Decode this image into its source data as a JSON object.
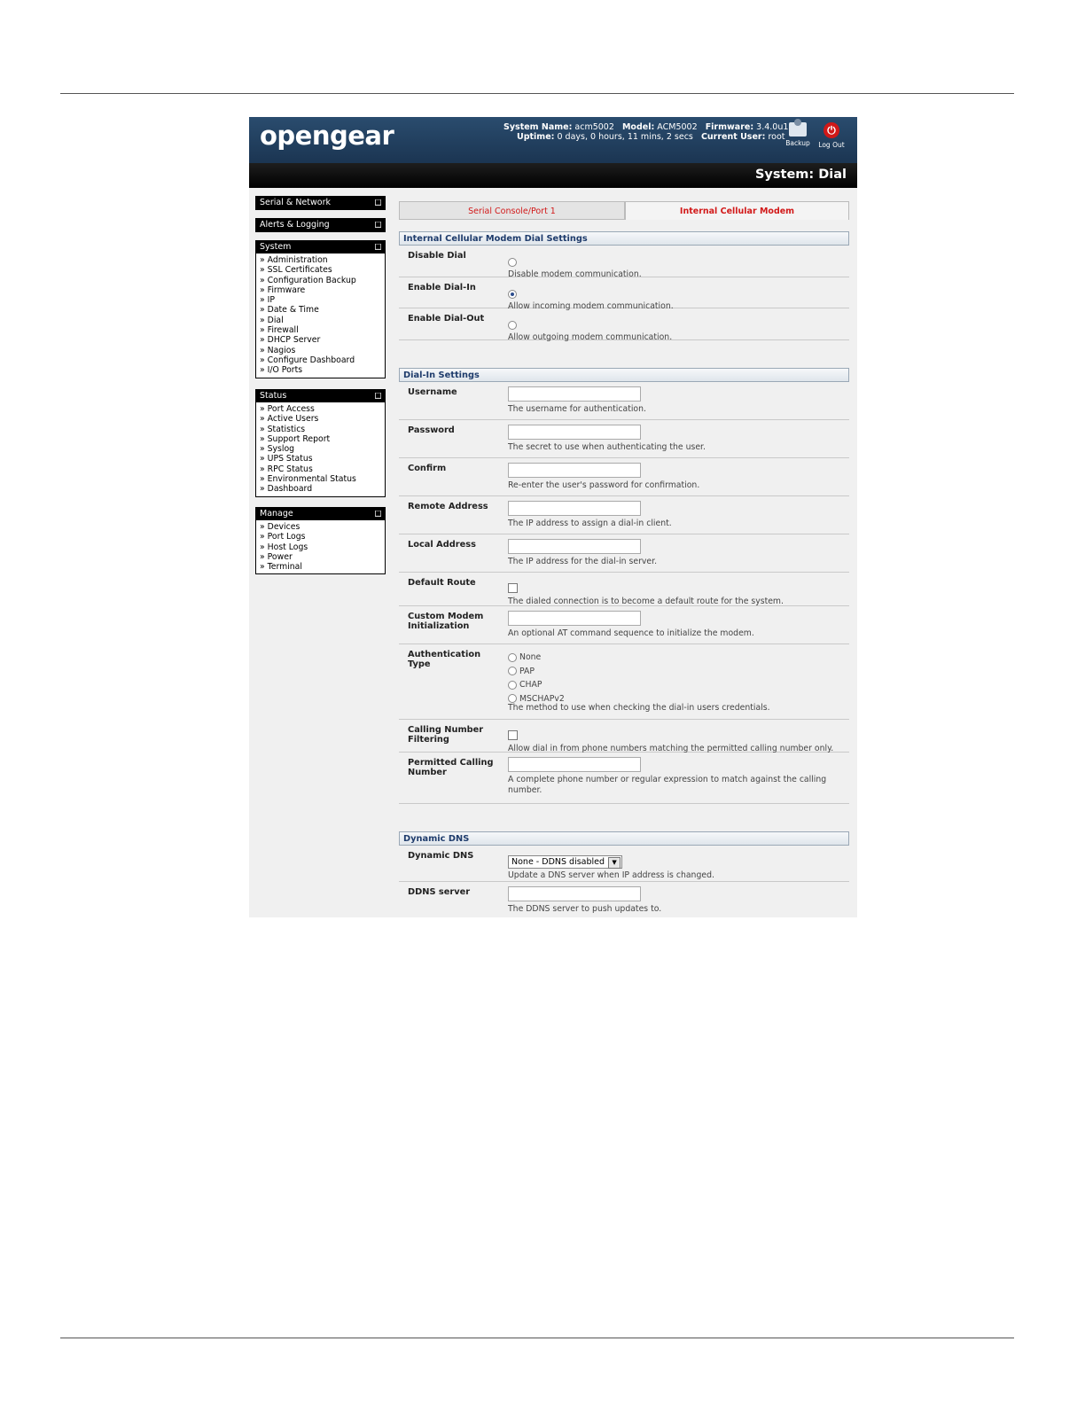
{
  "header": {
    "logo": "opengear",
    "system_name_label": "System Name:",
    "system_name": "acm5002",
    "model_label": "Model:",
    "model": "ACM5002",
    "firmware_label": "Firmware:",
    "firmware": "3.4.0u1",
    "uptime_label": "Uptime:",
    "uptime": "0 days, 0 hours, 11 mins, 2 secs",
    "current_user_label": "Current User:",
    "current_user": "root",
    "backup_label": "Backup",
    "logout_label": "Log Out",
    "page_title": "System: Dial"
  },
  "sidebar": {
    "serial_network": "Serial & Network",
    "alerts_logging": "Alerts & Logging",
    "system": {
      "title": "System",
      "items": [
        "Administration",
        "SSL Certificates",
        "Configuration Backup",
        "Firmware",
        "IP",
        "Date & Time",
        "Dial",
        "Firewall",
        "DHCP Server",
        "Nagios",
        "Configure Dashboard",
        "I/O Ports"
      ]
    },
    "status": {
      "title": "Status",
      "items": [
        "Port Access",
        "Active Users",
        "Statistics",
        "Support Report",
        "Syslog",
        "UPS Status",
        "RPC Status",
        "Environmental Status",
        "Dashboard"
      ]
    },
    "manage": {
      "title": "Manage",
      "items": [
        "Devices",
        "Port Logs",
        "Host Logs",
        "Power",
        "Terminal"
      ]
    },
    "toggle_glyph": "■"
  },
  "tabs": [
    "Serial Console/Port 1",
    "Internal Cellular Modem"
  ],
  "modem_section": {
    "title": "Internal Cellular Modem Dial Settings",
    "rows": [
      {
        "label": "Disable Dial",
        "desc": "Disable modem communication.",
        "checked": false
      },
      {
        "label": "Enable Dial-In",
        "desc": "Allow incoming modem communication.",
        "checked": true
      },
      {
        "label": "Enable Dial-Out",
        "desc": "Allow outgoing modem communication.",
        "checked": false
      }
    ]
  },
  "dialin_section": {
    "title": "Dial-In Settings",
    "username": {
      "label": "Username",
      "desc": "The username for authentication.",
      "value": ""
    },
    "password": {
      "label": "Password",
      "desc": "The secret to use when authenticating the user.",
      "value": ""
    },
    "confirm": {
      "label": "Confirm",
      "desc": "Re-enter the user's password for confirmation.",
      "value": ""
    },
    "remote_address": {
      "label": "Remote Address",
      "desc": "The IP address to assign a dial-in client.",
      "value": ""
    },
    "local_address": {
      "label": "Local Address",
      "desc": "The IP address for the dial-in server.",
      "value": ""
    },
    "default_route": {
      "label": "Default Route",
      "desc": "The dialed connection is to become a default route for the system.",
      "checked": false
    },
    "custom_init": {
      "label": "Custom Modem Initialization",
      "desc": "An optional AT command sequence to initialize the modem.",
      "value": ""
    },
    "auth_type": {
      "label": "Authentication Type",
      "options": [
        "None",
        "PAP",
        "CHAP",
        "MSCHAPv2"
      ],
      "desc": "The method to use when checking the dial-in users credentials."
    },
    "calling_filter": {
      "label": "Calling Number Filtering",
      "desc": "Allow dial in from phone numbers matching the permitted calling number only.",
      "checked": false
    },
    "permitted_number": {
      "label": "Permitted Calling Number",
      "desc": "A complete phone number or regular expression to match against the calling number.",
      "value": ""
    }
  },
  "ddns_section": {
    "title": "Dynamic DNS",
    "dynamic_dns": {
      "label": "Dynamic DNS",
      "selected": "None - DDNS disabled",
      "desc": "Update a DNS server when IP address is changed."
    },
    "ddns_server": {
      "label": "DDNS server",
      "desc": "The DDNS server to push updates to.",
      "value": ""
    }
  }
}
